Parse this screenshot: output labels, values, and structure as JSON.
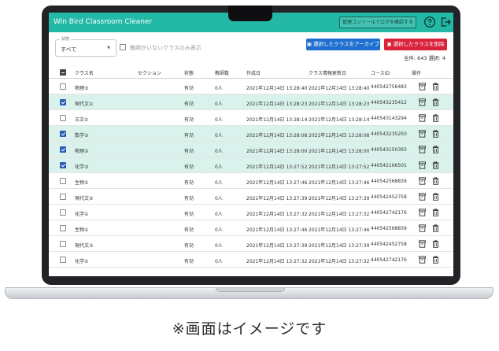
{
  "app": {
    "title": "Win Bird Classroom Cleaner",
    "console_button": "管理コンソールでログを確認する"
  },
  "filter": {
    "status_legend": "状態",
    "status_value": "すべて",
    "no_teacher_label": "教師がいないクラスのみ表示"
  },
  "actions": {
    "archive_label": "選択したクラスをアーカイブ",
    "delete_label": "選択したクラスを削除",
    "count_text": "全件: 643 選択: 4"
  },
  "table": {
    "headers": {
      "name": "クラス名",
      "section": "セクション",
      "status": "状態",
      "teachers": "教師数",
      "created": "作成日",
      "updated": "クラス情報更新日",
      "code": "コースID",
      "ops": "操作"
    },
    "rows": [
      {
        "name": "物理③",
        "section": "",
        "status": "有効",
        "teachers": "0人",
        "created": "2021年12月14日 13:28:40",
        "updated": "2021年12月14日 13:28:40",
        "code": "440542756483",
        "selected": false
      },
      {
        "name": "現代文①",
        "section": "",
        "status": "有効",
        "teachers": "0人",
        "created": "2021年12月14日 13:28:23",
        "updated": "2021年12月14日 13:28:23",
        "code": "440543235412",
        "selected": true
      },
      {
        "name": "古文①",
        "section": "",
        "status": "有効",
        "teachers": "0人",
        "created": "2021年12月14日 13:28:14",
        "updated": "2021年12月14日 13:28:14",
        "code": "440543143294",
        "selected": false
      },
      {
        "name": "数学②",
        "section": "",
        "status": "有効",
        "teachers": "0人",
        "created": "2021年12月14日 13:28:08",
        "updated": "2021年12月14日 13:28:08",
        "code": "440543235250",
        "selected": true
      },
      {
        "name": "物理②",
        "section": "",
        "status": "有効",
        "teachers": "0人",
        "created": "2021年12月14日 13:28:00",
        "updated": "2021年12月14日 13:28:00",
        "code": "440543150393",
        "selected": true
      },
      {
        "name": "化学③",
        "section": "",
        "status": "有効",
        "teachers": "0人",
        "created": "2021年12月14日 13:27:52",
        "updated": "2021年12月14日 13:27:52",
        "code": "440542166501",
        "selected": true
      },
      {
        "name": "生物①",
        "section": "",
        "status": "有効",
        "teachers": "0人",
        "created": "2021年12月14日 13:27:46",
        "updated": "2021年12月14日 13:27:46",
        "code": "440542568839",
        "selected": false
      },
      {
        "name": "現代文②",
        "section": "",
        "status": "有効",
        "teachers": "0人",
        "created": "2021年12月14日 13:27:39",
        "updated": "2021年12月14日 13:27:39",
        "code": "440542452758",
        "selected": false
      },
      {
        "name": "化学①",
        "section": "",
        "status": "有効",
        "teachers": "0人",
        "created": "2021年12月14日 13:27:32",
        "updated": "2021年12月14日 13:27:32",
        "code": "440542742176",
        "selected": false
      },
      {
        "name": "生物①",
        "section": "",
        "status": "有効",
        "teachers": "0人",
        "created": "2021年12月14日 13:27:46",
        "updated": "2021年12月14日 13:27:46",
        "code": "440542568839",
        "selected": false
      },
      {
        "name": "現代文②",
        "section": "",
        "status": "有効",
        "teachers": "0人",
        "created": "2021年12月14日 13:27:39",
        "updated": "2021年12月14日 13:27:39",
        "code": "440542452758",
        "selected": false
      },
      {
        "name": "化学①",
        "section": "",
        "status": "有効",
        "teachers": "0人",
        "created": "2021年12月14日 13:27:32",
        "updated": "2021年12月14日 13:27:32",
        "code": "440542742176",
        "selected": false
      }
    ]
  },
  "caption": "※画面はイメージです",
  "colors": {
    "header": "#23b9a6",
    "archive": "#1f6fd0",
    "delete": "#d9233b",
    "selected_row": "#daf2ec",
    "checkbox_on": "#2b5db8"
  },
  "icons": [
    "help-circle-icon",
    "logout-icon",
    "archive-icon",
    "trash-icon",
    "chevron-down-icon"
  ]
}
